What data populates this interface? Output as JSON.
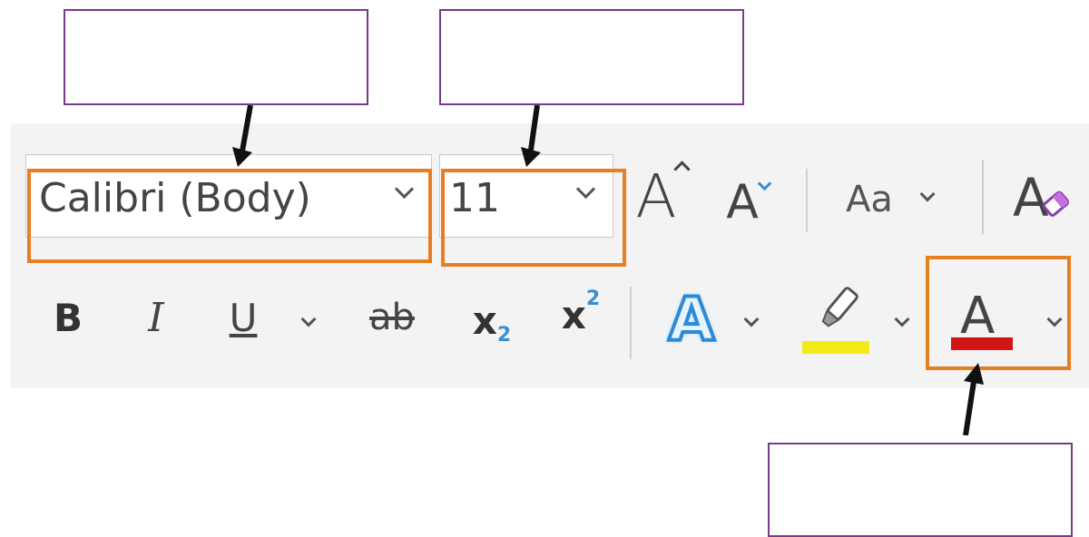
{
  "font": {
    "name": "Calibri (Body)",
    "size": "11"
  },
  "toolbar": {
    "grow_font_glyph": "A",
    "shrink_font_glyph": "A",
    "change_case_label": "Aa",
    "bold_label": "B",
    "italic_label": "I",
    "underline_label": "U",
    "strikethrough_label": "ab",
    "subscript_base": "x",
    "subscript_index": "2",
    "superscript_base": "x",
    "superscript_index": "2",
    "text_effects_glyph": "A",
    "font_color_glyph": "A"
  },
  "colors": {
    "highlight_color": "#f5e919",
    "font_color": "#d11414",
    "callout_border": "#e67e22",
    "label_box_border": "#7a3a8a"
  },
  "icons": [
    "chevron-down-icon",
    "grow-font-icon",
    "shrink-font-icon",
    "clear-formatting-icon",
    "text-effects-icon",
    "highlighter-icon",
    "font-color-icon"
  ]
}
